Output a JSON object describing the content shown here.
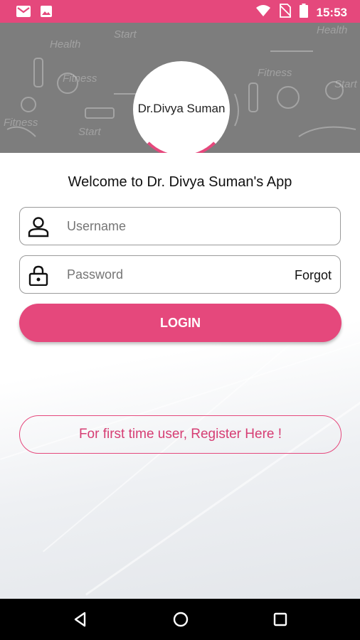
{
  "status_bar": {
    "time": "15:53",
    "left_icons": [
      "gmail-icon",
      "image-icon"
    ],
    "right_icons": [
      "wifi-icon",
      "no-sim-icon",
      "battery-icon"
    ]
  },
  "header": {
    "logo_text": "Dr.Divya Suman",
    "background_doodles": [
      "Health",
      "Fitness",
      "Start",
      "Fitness",
      "Start",
      "Health",
      "Fitness",
      "Start"
    ]
  },
  "login": {
    "welcome": "Welcome to Dr. Divya Suman's App",
    "username_placeholder": "Username",
    "password_placeholder": "Password",
    "forgot_label": "Forgot",
    "login_label": "LOGIN",
    "register_label": "For first time user, Register Here !"
  },
  "nav_bar": {
    "buttons": [
      "back-icon",
      "home-icon",
      "recents-icon"
    ]
  },
  "colors": {
    "accent": "#e5487c",
    "header_bg": "#7d7d7d",
    "text_accent": "#d63d73"
  }
}
